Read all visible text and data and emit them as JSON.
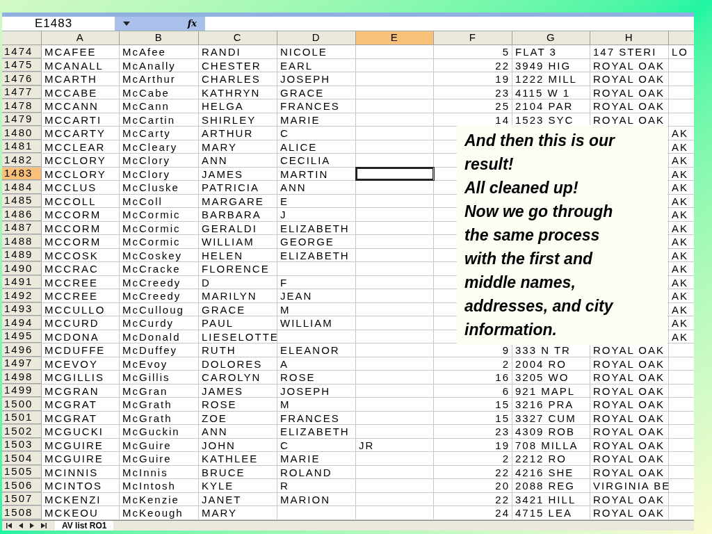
{
  "name_box": "E1483",
  "formula_label": "fx",
  "columns": [
    {
      "label": "A",
      "selected": false
    },
    {
      "label": "B",
      "selected": false
    },
    {
      "label": "C",
      "selected": false
    },
    {
      "label": "D",
      "selected": false
    },
    {
      "label": "E",
      "selected": true
    },
    {
      "label": "F",
      "selected": false
    },
    {
      "label": "G",
      "selected": false
    },
    {
      "label": "H",
      "selected": false
    },
    {
      "selected": false
    }
  ],
  "rows": [
    {
      "number": "1474",
      "selected": false,
      "cells": [
        "MCAFEE",
        "McAfee",
        "RANDI",
        "NICOLE",
        "",
        "5",
        "FLAT 3",
        "147 STERI",
        "LO"
      ]
    },
    {
      "number": "1475",
      "selected": false,
      "cells": [
        "MCANALL",
        "McAnally",
        "CHESTER",
        "EARL",
        "",
        "22",
        "3949 HIG",
        "ROYAL OAK",
        ""
      ]
    },
    {
      "number": "1476",
      "selected": false,
      "cells": [
        "MCARTH",
        "McArthur",
        "CHARLES",
        "JOSEPH",
        "",
        "19",
        "1222 MILL",
        "ROYAL OAK",
        ""
      ]
    },
    {
      "number": "1477",
      "selected": false,
      "cells": [
        "MCCABE",
        "McCabe",
        "KATHRYN",
        "GRACE",
        "",
        "23",
        "4115 W 1",
        "ROYAL OAK",
        ""
      ]
    },
    {
      "number": "1478",
      "selected": false,
      "cells": [
        "MCCANN",
        "McCann",
        "HELGA",
        "FRANCES",
        "",
        "25",
        "2104 PAR",
        "ROYAL OAK",
        ""
      ]
    },
    {
      "number": "1479",
      "selected": false,
      "cells": [
        "MCCARTI",
        "McCartin",
        "SHIRLEY",
        "MARIE",
        "",
        "14",
        "1523 SYC",
        "ROYAL OAK",
        ""
      ]
    },
    {
      "number": "1480",
      "selected": false,
      "cells": [
        "MCCARTY",
        "McCarty",
        "ARTHUR",
        "C",
        "",
        "",
        "",
        "",
        "AK"
      ]
    },
    {
      "number": "1481",
      "selected": false,
      "cells": [
        "MCCLEAR",
        "McCleary",
        "MARY",
        "ALICE",
        "",
        "",
        "",
        "",
        "AK"
      ]
    },
    {
      "number": "1482",
      "selected": false,
      "cells": [
        "MCCLORY",
        "McClory",
        "ANN",
        "CECILIA",
        "",
        "",
        "",
        "",
        "AK"
      ]
    },
    {
      "number": "1483",
      "selected": true,
      "cells": [
        "MCCLORY",
        "McClory",
        "JAMES",
        "MARTIN",
        "",
        "",
        "",
        "",
        "AK"
      ]
    },
    {
      "number": "1484",
      "selected": false,
      "cells": [
        "MCCLUS",
        "McCluske",
        "PATRICIA",
        "ANN",
        "",
        "",
        "",
        "",
        "AK"
      ]
    },
    {
      "number": "1485",
      "selected": false,
      "cells": [
        "MCCOLL",
        "McColl",
        "MARGARE",
        "E",
        "",
        "",
        "",
        "",
        "AK"
      ]
    },
    {
      "number": "1486",
      "selected": false,
      "cells": [
        "MCCORM",
        "McCormic",
        "BARBARA",
        "J",
        "",
        "",
        "",
        "",
        "AK"
      ]
    },
    {
      "number": "1487",
      "selected": false,
      "cells": [
        "MCCORM",
        "McCormic",
        "GERALDI",
        "ELIZABETH",
        "",
        "",
        "",
        "",
        "AK"
      ]
    },
    {
      "number": "1488",
      "selected": false,
      "cells": [
        "MCCORM",
        "McCormic",
        "WILLIAM",
        "GEORGE",
        "",
        "",
        "",
        "",
        "AK"
      ]
    },
    {
      "number": "1489",
      "selected": false,
      "cells": [
        "MCCOSK",
        "McCoskey",
        "HELEN",
        "ELIZABETH",
        "",
        "",
        "",
        "",
        "AK"
      ]
    },
    {
      "number": "1490",
      "selected": false,
      "cells": [
        "MCCRAC",
        "McCracke",
        "FLORENCE",
        "",
        "",
        "",
        "",
        "",
        "AK"
      ]
    },
    {
      "number": "1491",
      "selected": false,
      "cells": [
        "MCCREE",
        "McCreedy",
        "D",
        "F",
        "",
        "",
        "",
        "",
        "AK"
      ]
    },
    {
      "number": "1492",
      "selected": false,
      "cells": [
        "MCCREE",
        "McCreedy",
        "MARILYN",
        "JEAN",
        "",
        "",
        "",
        "",
        "AK"
      ]
    },
    {
      "number": "1493",
      "selected": false,
      "cells": [
        "MCCULLO",
        "McCulloug",
        "GRACE",
        "M",
        "",
        "",
        "",
        "",
        "AK"
      ]
    },
    {
      "number": "1494",
      "selected": false,
      "cells": [
        "MCCURD",
        "McCurdy",
        "PAUL",
        "WILLIAM",
        "",
        "",
        "",
        "",
        "AK"
      ]
    },
    {
      "number": "1495",
      "selected": false,
      "cells": [
        "MCDONA",
        "McDonald",
        "LIESELOTTE",
        "",
        "",
        "",
        "",
        "",
        "AK"
      ]
    },
    {
      "number": "1496",
      "selected": false,
      "cells": [
        "MCDUFFE",
        "McDuffey",
        "RUTH",
        "ELEANOR",
        "",
        "9",
        "333 N TR",
        "ROYAL OAK",
        ""
      ]
    },
    {
      "number": "1497",
      "selected": false,
      "cells": [
        "MCEVOY",
        "McEvoy",
        "DOLORES",
        "A",
        "",
        "2",
        "2004 RO",
        "ROYAL OAK",
        ""
      ]
    },
    {
      "number": "1498",
      "selected": false,
      "cells": [
        "MCGILLIS",
        "McGillis",
        "CAROLYN",
        "ROSE",
        "",
        "16",
        "3205 WO",
        "ROYAL OAK",
        ""
      ]
    },
    {
      "number": "1499",
      "selected": false,
      "cells": [
        "MCGRAN",
        "McGran",
        "JAMES",
        "JOSEPH",
        "",
        "6",
        "921 MAPL",
        "ROYAL OAK",
        ""
      ]
    },
    {
      "number": "1500",
      "selected": false,
      "cells": [
        "MCGRAT",
        "McGrath",
        "ROSE",
        "M",
        "",
        "15",
        "3216 PRA",
        "ROYAL OAK",
        ""
      ]
    },
    {
      "number": "1501",
      "selected": false,
      "cells": [
        "MCGRAT",
        "McGrath",
        "ZOE",
        "FRANCES",
        "",
        "15",
        "3327 CUM",
        "ROYAL OAK",
        ""
      ]
    },
    {
      "number": "1502",
      "selected": false,
      "cells": [
        "MCGUCKI",
        "McGuckin",
        "ANN",
        "ELIZABETH",
        "",
        "23",
        "4309 ROB",
        "ROYAL OAK",
        ""
      ]
    },
    {
      "number": "1503",
      "selected": false,
      "cells": [
        "MCGUIRE",
        "McGuire",
        "JOHN",
        "C",
        "JR",
        "19",
        "708 MILLA",
        "ROYAL OAK",
        ""
      ]
    },
    {
      "number": "1504",
      "selected": false,
      "cells": [
        "MCGUIRE",
        "McGuire",
        "KATHLEE",
        "MARIE",
        "",
        "2",
        "2212 RO",
        "ROYAL OAK",
        ""
      ]
    },
    {
      "number": "1505",
      "selected": false,
      "cells": [
        "MCINNIS",
        "McInnis",
        "BRUCE",
        "ROLAND",
        "",
        "22",
        "4216 SHE",
        "ROYAL OAK",
        ""
      ]
    },
    {
      "number": "1506",
      "selected": false,
      "cells": [
        "MCINTOS",
        "McIntosh",
        "KYLE",
        "R",
        "",
        "20",
        "2088 REG",
        "VIRGINIA BE",
        ""
      ]
    },
    {
      "number": "1507",
      "selected": false,
      "cells": [
        "MCKENZI",
        "McKenzie",
        "JANET",
        "MARION",
        "",
        "22",
        "3421 HILL",
        "ROYAL OAK",
        ""
      ]
    },
    {
      "number": "1508",
      "selected": false,
      "cells": [
        "MCKEOU",
        "McKeough",
        "MARY",
        "",
        "",
        "24",
        "4715 LEA",
        "ROYAL OAK",
        ""
      ]
    }
  ],
  "note": {
    "lines": [
      "And then this is our",
      "result!",
      "All cleaned up!",
      "Now we go through",
      "the same process",
      "with the first and",
      "middle names,",
      "addresses, and city",
      "information."
    ]
  },
  "sheet_tabs": [
    {
      "label": "AV list RO1",
      "selected": true
    }
  ]
}
